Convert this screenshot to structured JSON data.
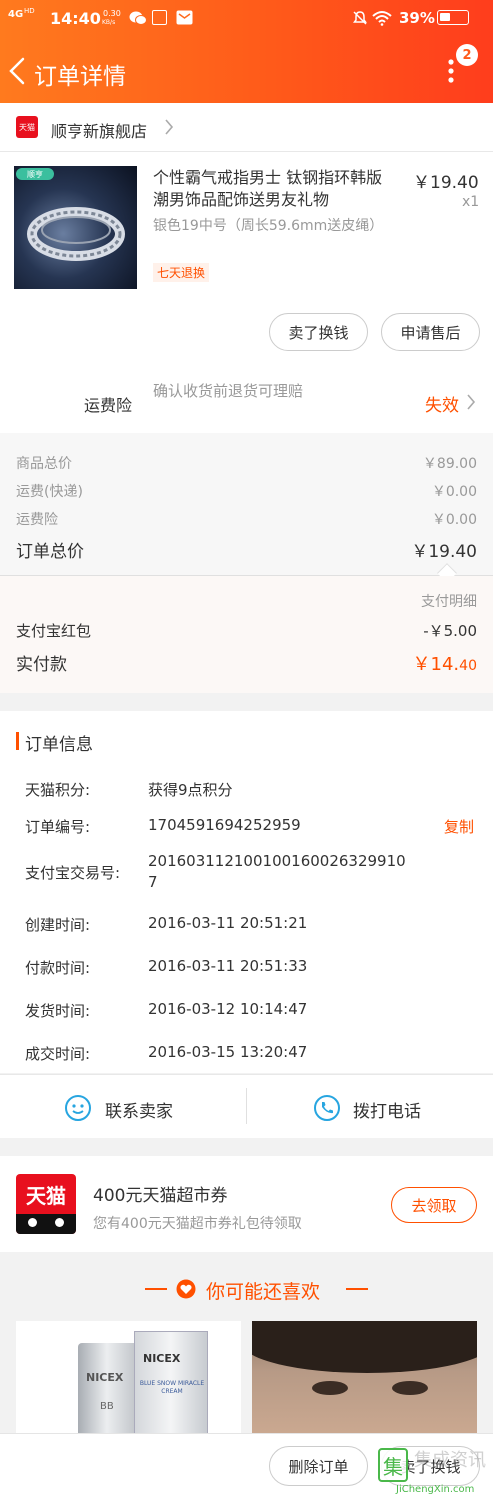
{
  "status_bar": {
    "network": "4G",
    "hd": "HD",
    "time": "14:40",
    "speed_top": "0.30",
    "speed_bottom": "KB/s",
    "battery": "39%"
  },
  "header": {
    "title": "订单详情",
    "badge": "2"
  },
  "shop": {
    "logo_text": "天猫",
    "name": "顺亨新旗舰店"
  },
  "product": {
    "thumb_tag": "顺亨",
    "title": "个性霸气戒指男士 钛钢指环韩版潮男饰品配饰送男友礼物",
    "spec": "银色19中号（周长59.6mm送皮绳）",
    "tag": "七天退换",
    "price": "￥19.40",
    "qty": "x1",
    "btn_resell": "卖了换钱",
    "btn_after_sale": "申请售后"
  },
  "insurance": {
    "label": "运费险",
    "desc": "确认收货前退货可理赔",
    "status": "失效"
  },
  "amounts": [
    {
      "label": "商品总价",
      "value": "￥89.00"
    },
    {
      "label": "运费(快递)",
      "value": "￥0.00"
    },
    {
      "label": "运费险",
      "value": "￥0.00"
    }
  ],
  "total": {
    "label": "订单总价",
    "value": "￥19.40"
  },
  "payment": {
    "detail_link": "支付明细",
    "redpacket_label": "支付宝红包",
    "redpacket_value": "-￥5.00",
    "paid_label": "实付款",
    "paid_yuan": "￥14.",
    "paid_cents": "40"
  },
  "order_info": {
    "title": "订单信息",
    "copy": "复制",
    "rows": [
      {
        "label": "天猫积分:",
        "value": "获得9点积分"
      },
      {
        "label": "订单编号:",
        "value": "1704591694252959"
      },
      {
        "label": "支付宝交易号:",
        "value": "2016031121001001600263299107"
      },
      {
        "label": "创建时间:",
        "value": "2016-03-11 20:51:21"
      },
      {
        "label": "付款时间:",
        "value": "2016-03-11 20:51:33"
      },
      {
        "label": "发货时间:",
        "value": "2016-03-12 10:14:47"
      },
      {
        "label": "成交时间:",
        "value": "2016-03-15 13:20:47"
      }
    ]
  },
  "contact": {
    "seller": "联系卖家",
    "phone": "拨打电话"
  },
  "promo": {
    "logo_text": "天猫",
    "title": "400元天猫超市券",
    "subtitle": "您有400元天猫超市券礼包待领取",
    "button": "去领取"
  },
  "recommend": {
    "title": "你可能还喜欢",
    "product1_brand": "NICEX",
    "product1_small": "BB",
    "product1_box": "BLUE SNOW MIRACLE CREAM"
  },
  "bottom_bar": {
    "delete": "删除订单",
    "resell": "卖了换钱"
  },
  "watermark": {
    "char": "集",
    "site": "JiChengXin.com",
    "name": "集成资讯"
  },
  "colors": {
    "orange": "#ff5000",
    "header_start": "#ff7a1e",
    "header_end": "#ff3d1c",
    "tmall_red": "#e8101e"
  }
}
